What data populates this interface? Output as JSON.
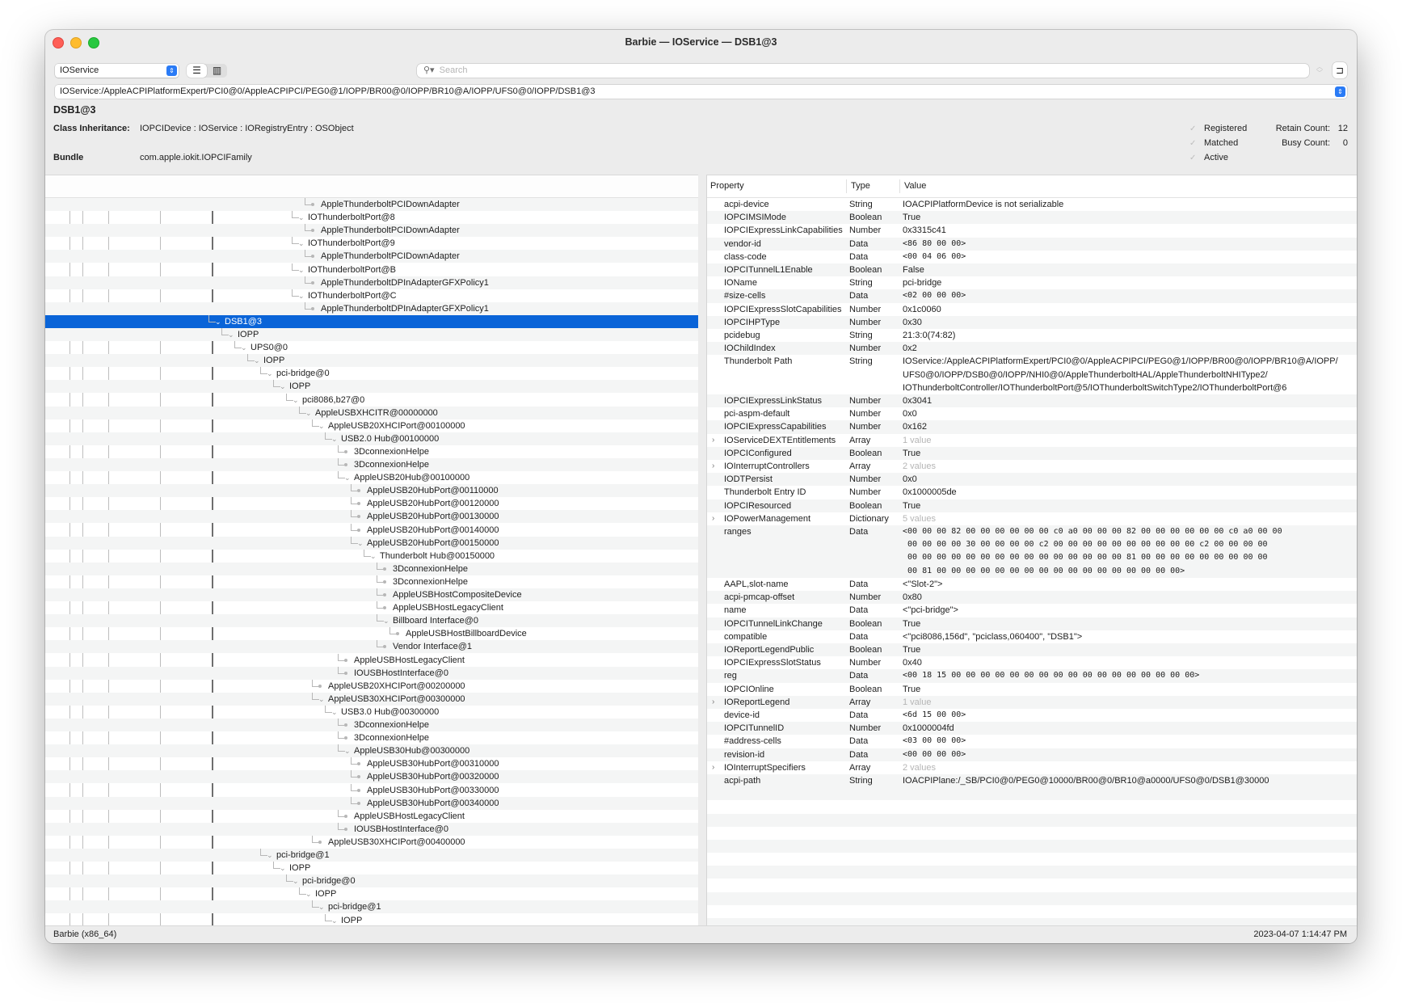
{
  "window": {
    "title": "Barbie — IOService — DSB1@3",
    "plane_popup": "IOService",
    "search_placeholder": "Search",
    "path": "IOService:/AppleACPIPlatformExpert/PCI0@0/AppleACPIPCI/PEG0@1/IOPP/BR00@0/IOPP/BR10@A/IOPP/UFS0@0/IOPP/DSB1@3"
  },
  "info": {
    "node_name": "DSB1@3",
    "class_inheritance_label": "Class Inheritance:",
    "class_inheritance": "IOPCIDevice : IOService : IORegistryEntry : OSObject",
    "bundle_label": "Bundle",
    "bundle": "com.apple.iokit.IOPCIFamily",
    "flags": [
      {
        "label": "Registered",
        "checked": true
      },
      {
        "label": "Matched",
        "checked": true
      },
      {
        "label": "Active",
        "checked": true
      }
    ],
    "retain_count_label": "Retain Count:",
    "retain_count": "12",
    "busy_count_label": "Busy Count:",
    "busy_count": "0"
  },
  "tree": [
    {
      "label": "AppleThunderboltPCIDownAdapter",
      "depth": 10,
      "leaf": true
    },
    {
      "label": "IOThunderboltPort@8",
      "depth": 9,
      "leaf": false
    },
    {
      "label": "AppleThunderboltPCIDownAdapter",
      "depth": 10,
      "leaf": true
    },
    {
      "label": "IOThunderboltPort@9",
      "depth": 9,
      "leaf": false
    },
    {
      "label": "AppleThunderboltPCIDownAdapter",
      "depth": 10,
      "leaf": true
    },
    {
      "label": "IOThunderboltPort@B",
      "depth": 9,
      "leaf": false
    },
    {
      "label": "AppleThunderboltDPInAdapterGFXPolicy1",
      "depth": 10,
      "leaf": true
    },
    {
      "label": "IOThunderboltPort@C",
      "depth": 9,
      "leaf": false
    },
    {
      "label": "AppleThunderboltDPInAdapterGFXPolicy1",
      "depth": 10,
      "leaf": true
    },
    {
      "label": "DSB1@3",
      "depth": 0,
      "leaf": false,
      "selected": true
    },
    {
      "label": "IOPP",
      "depth": 1,
      "leaf": false
    },
    {
      "label": "UPS0@0",
      "depth": 2,
      "leaf": false
    },
    {
      "label": "IOPP",
      "depth": 3,
      "leaf": false
    },
    {
      "label": "pci-bridge@0",
      "depth": 4,
      "leaf": false
    },
    {
      "label": "IOPP",
      "depth": 5,
      "leaf": false
    },
    {
      "label": "pci8086,b27@0",
      "depth": 6,
      "leaf": false
    },
    {
      "label": "AppleUSBXHCITR@00000000",
      "depth": 7,
      "leaf": false
    },
    {
      "label": "AppleUSB20XHCIPort@00100000",
      "depth": 8,
      "leaf": false
    },
    {
      "label": "USB2.0 Hub@00100000",
      "depth": 9,
      "leaf": false
    },
    {
      "label": "3DconnexionHelpe",
      "depth": 10,
      "leaf": true
    },
    {
      "label": "3DconnexionHelpe",
      "depth": 10,
      "leaf": true
    },
    {
      "label": "AppleUSB20Hub@00100000",
      "depth": 10,
      "leaf": false
    },
    {
      "label": "AppleUSB20HubPort@00110000",
      "depth": 11,
      "leaf": true
    },
    {
      "label": "AppleUSB20HubPort@00120000",
      "depth": 11,
      "leaf": true
    },
    {
      "label": "AppleUSB20HubPort@00130000",
      "depth": 11,
      "leaf": true
    },
    {
      "label": "AppleUSB20HubPort@00140000",
      "depth": 11,
      "leaf": true
    },
    {
      "label": "AppleUSB20HubPort@00150000",
      "depth": 11,
      "leaf": false
    },
    {
      "label": "Thunderbolt Hub@00150000",
      "depth": 12,
      "leaf": false
    },
    {
      "label": "3DconnexionHelpe",
      "depth": 13,
      "leaf": true
    },
    {
      "label": "3DconnexionHelpe",
      "depth": 13,
      "leaf": true
    },
    {
      "label": "AppleUSBHostCompositeDevice",
      "depth": 13,
      "leaf": true
    },
    {
      "label": "AppleUSBHostLegacyClient",
      "depth": 13,
      "leaf": true
    },
    {
      "label": "Billboard Interface@0",
      "depth": 13,
      "leaf": false
    },
    {
      "label": "AppleUSBHostBillboardDevice",
      "depth": 14,
      "leaf": true
    },
    {
      "label": "Vendor Interface@1",
      "depth": 13,
      "leaf": true
    },
    {
      "label": "AppleUSBHostLegacyClient",
      "depth": 10,
      "leaf": true
    },
    {
      "label": "IOUSBHostInterface@0",
      "depth": 10,
      "leaf": true
    },
    {
      "label": "AppleUSB20XHCIPort@00200000",
      "depth": 8,
      "leaf": true
    },
    {
      "label": "AppleUSB30XHCIPort@00300000",
      "depth": 8,
      "leaf": false
    },
    {
      "label": "USB3.0 Hub@00300000",
      "depth": 9,
      "leaf": false
    },
    {
      "label": "3DconnexionHelpe",
      "depth": 10,
      "leaf": true
    },
    {
      "label": "3DconnexionHelpe",
      "depth": 10,
      "leaf": true
    },
    {
      "label": "AppleUSB30Hub@00300000",
      "depth": 10,
      "leaf": false
    },
    {
      "label": "AppleUSB30HubPort@00310000",
      "depth": 11,
      "leaf": true
    },
    {
      "label": "AppleUSB30HubPort@00320000",
      "depth": 11,
      "leaf": true
    },
    {
      "label": "AppleUSB30HubPort@00330000",
      "depth": 11,
      "leaf": true
    },
    {
      "label": "AppleUSB30HubPort@00340000",
      "depth": 11,
      "leaf": true
    },
    {
      "label": "AppleUSBHostLegacyClient",
      "depth": 10,
      "leaf": true
    },
    {
      "label": "IOUSBHostInterface@0",
      "depth": 10,
      "leaf": true
    },
    {
      "label": "AppleUSB30XHCIPort@00400000",
      "depth": 8,
      "leaf": true
    },
    {
      "label": "pci-bridge@1",
      "depth": 4,
      "leaf": false
    },
    {
      "label": "IOPP",
      "depth": 5,
      "leaf": false
    },
    {
      "label": "pci-bridge@0",
      "depth": 6,
      "leaf": false
    },
    {
      "label": "IOPP",
      "depth": 7,
      "leaf": false
    },
    {
      "label": "pci-bridge@1",
      "depth": 8,
      "leaf": false
    },
    {
      "label": "IOPP",
      "depth": 9,
      "leaf": false
    }
  ],
  "properties": {
    "headers": {
      "property": "Property",
      "type": "Type",
      "value": "Value"
    },
    "rows": [
      {
        "key": "acpi-device",
        "type": "String",
        "value": "IOACPIPlatformDevice is not serializable"
      },
      {
        "key": "IOPCIMSIMode",
        "type": "Boolean",
        "value": "True"
      },
      {
        "key": "IOPCIExpressLinkCapabilities",
        "type": "Number",
        "value": "0x3315c41"
      },
      {
        "key": "vendor-id",
        "type": "Data",
        "value": "<86 80 00 00>",
        "mono": true
      },
      {
        "key": "class-code",
        "type": "Data",
        "value": "<00 04 06 00>",
        "mono": true
      },
      {
        "key": "IOPCITunnelL1Enable",
        "type": "Boolean",
        "value": "False"
      },
      {
        "key": "IOName",
        "type": "String",
        "value": "pci-bridge"
      },
      {
        "key": "#size-cells",
        "type": "Data",
        "value": "<02 00 00 00>",
        "mono": true
      },
      {
        "key": "IOPCIExpressSlotCapabilities",
        "type": "Number",
        "value": "0x1c0060"
      },
      {
        "key": "IOPCIHPType",
        "type": "Number",
        "value": "0x30"
      },
      {
        "key": "pcidebug",
        "type": "String",
        "value": "21:3:0(74:82)"
      },
      {
        "key": "IOChildIndex",
        "type": "Number",
        "value": "0x2"
      },
      {
        "key": "Thunderbolt Path",
        "type": "String",
        "value": "IOService:/AppleACPIPlatformExpert/PCI0@0/AppleACPIPCI/PEG0@1/IOPP/BR00@0/IOPP/BR10@A/IOPP/\nUFS0@0/IOPP/DSB0@0/IOPP/NHI0@0/AppleThunderboltHAL/AppleThunderboltNHIType2/\nIOThunderboltController/IOThunderboltPort@5/IOThunderboltSwitchType2/IOThunderboltPort@6"
      },
      {
        "key": "IOPCIExpressLinkStatus",
        "type": "Number",
        "value": "0x3041"
      },
      {
        "key": "pci-aspm-default",
        "type": "Number",
        "value": "0x0"
      },
      {
        "key": "IOPCIExpressCapabilities",
        "type": "Number",
        "value": "0x162"
      },
      {
        "key": "IOServiceDEXTEntitlements",
        "type": "Array",
        "value": "1 value",
        "expandable": true,
        "muted": true
      },
      {
        "key": "IOPCIConfigured",
        "type": "Boolean",
        "value": "True"
      },
      {
        "key": "IOInterruptControllers",
        "type": "Array",
        "value": "2 values",
        "expandable": true,
        "muted": true
      },
      {
        "key": "IODTPersist",
        "type": "Number",
        "value": "0x0"
      },
      {
        "key": "Thunderbolt Entry ID",
        "type": "Number",
        "value": "0x1000005de"
      },
      {
        "key": "IOPCIResourced",
        "type": "Boolean",
        "value": "True"
      },
      {
        "key": "IOPowerManagement",
        "type": "Dictionary",
        "value": "5 values",
        "expandable": true,
        "muted": true
      },
      {
        "key": "ranges",
        "type": "Data",
        "value": "<00 00 00 82 00 00 00 00 00 00 c0 a0 00 00 00 82 00 00 00 00 00 00 c0 a0 00 00\n 00 00 00 00 30 00 00 00 00 c2 00 00 00 00 00 00 00 00 00 00 c2 00 00 00 00\n 00 00 00 00 00 00 00 00 00 00 00 00 00 00 00 81 00 00 00 00 00 00 00 00 00\n 00 81 00 00 00 00 00 00 00 00 00 00 00 00 00 00 00 00 00>",
        "mono": true
      },
      {
        "key": "AAPL,slot-name",
        "type": "Data",
        "value": "<\"Slot-2\">"
      },
      {
        "key": "acpi-pmcap-offset",
        "type": "Number",
        "value": "0x80"
      },
      {
        "key": "name",
        "type": "Data",
        "value": "<\"pci-bridge\">"
      },
      {
        "key": "IOPCITunnelLinkChange",
        "type": "Boolean",
        "value": "True"
      },
      {
        "key": "compatible",
        "type": "Data",
        "value": "<\"pci8086,156d\", \"pciclass,060400\", \"DSB1\">"
      },
      {
        "key": "IOReportLegendPublic",
        "type": "Boolean",
        "value": "True"
      },
      {
        "key": "IOPCIExpressSlotStatus",
        "type": "Number",
        "value": "0x40"
      },
      {
        "key": "reg",
        "type": "Data",
        "value": "<00 18 15 00 00 00 00 00 00 00 00 00 00 00 00 00 00 00 00 00>",
        "mono": true
      },
      {
        "key": "IOPCIOnline",
        "type": "Boolean",
        "value": "True"
      },
      {
        "key": "IOReportLegend",
        "type": "Array",
        "value": "1 value",
        "expandable": true,
        "muted": true
      },
      {
        "key": "device-id",
        "type": "Data",
        "value": "<6d 15 00 00>",
        "mono": true
      },
      {
        "key": "IOPCITunnelID",
        "type": "Number",
        "value": "0x1000004fd"
      },
      {
        "key": "#address-cells",
        "type": "Data",
        "value": "<03 00 00 00>",
        "mono": true
      },
      {
        "key": "revision-id",
        "type": "Data",
        "value": "<00 00 00 00>",
        "mono": true
      },
      {
        "key": "IOInterruptSpecifiers",
        "type": "Array",
        "value": "2 values",
        "expandable": true,
        "muted": true
      },
      {
        "key": "acpi-path",
        "type": "String",
        "value": "IOACPIPlane:/_SB/PCI0@0/PEG0@10000/BR00@0/BR10@a0000/UFS0@0/DSB1@30000"
      }
    ]
  },
  "status": {
    "left": "Barbie (x86_64)",
    "right": "2023-04-07 1:14:47 PM"
  },
  "colors": {
    "selection": "#0a64d8",
    "close": "#fe5f57",
    "minimize": "#febc2e",
    "maximize": "#28c840"
  }
}
